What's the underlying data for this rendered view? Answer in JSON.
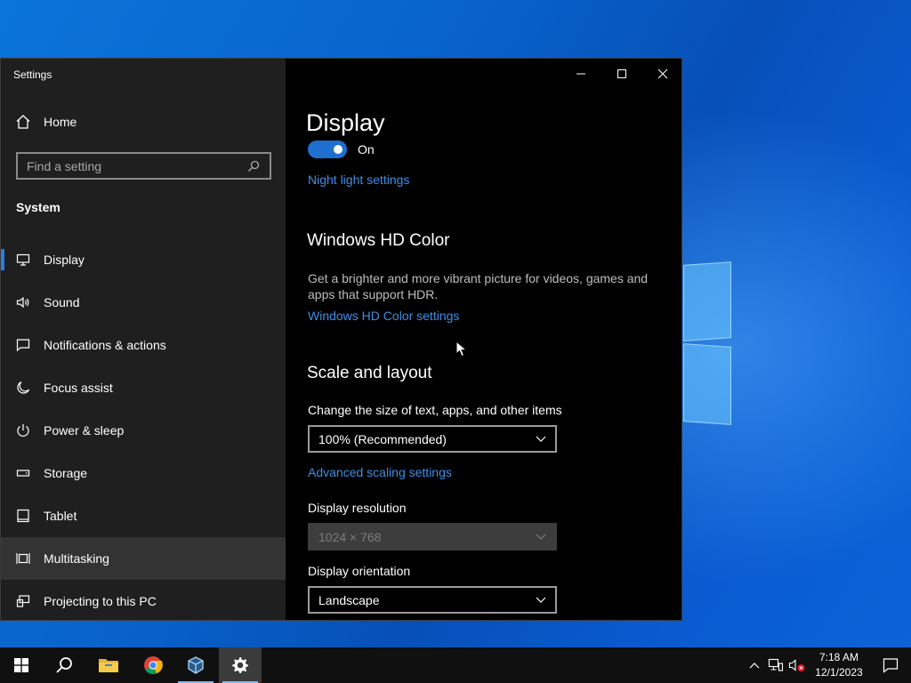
{
  "window": {
    "app_title": "Settings"
  },
  "sidebar": {
    "home_label": "Home",
    "search_placeholder": "Find a setting",
    "section_label": "System",
    "items": [
      {
        "label": "Display",
        "icon": "monitor-icon"
      },
      {
        "label": "Sound",
        "icon": "speaker-icon"
      },
      {
        "label": "Notifications & actions",
        "icon": "notification-icon"
      },
      {
        "label": "Focus assist",
        "icon": "moon-icon"
      },
      {
        "label": "Power & sleep",
        "icon": "power-icon"
      },
      {
        "label": "Storage",
        "icon": "storage-icon"
      },
      {
        "label": "Tablet",
        "icon": "tablet-icon"
      },
      {
        "label": "Multitasking",
        "icon": "multitasking-icon"
      },
      {
        "label": "Projecting to this PC",
        "icon": "projecting-icon"
      }
    ],
    "selected": "Display",
    "hovered": "Multitasking"
  },
  "content": {
    "page_title": "Display",
    "night_light_toggle": {
      "state_label": "On",
      "on": true
    },
    "night_light_link": "Night light settings",
    "hd_color": {
      "heading": "Windows HD Color",
      "description": "Get a brighter and more vibrant picture for videos, games and apps that support HDR.",
      "link": "Windows HD Color settings"
    },
    "scale_layout": {
      "heading": "Scale and layout",
      "scale_label": "Change the size of text, apps, and other items",
      "scale_value": "100% (Recommended)",
      "advanced_link": "Advanced scaling settings",
      "resolution_label": "Display resolution",
      "resolution_value": "1024 × 768",
      "orientation_label": "Display orientation",
      "orientation_value": "Landscape"
    }
  },
  "taskbar": {
    "apps": [
      "start-icon",
      "search-icon",
      "file-explorer-icon",
      "chrome-icon",
      "virtualbox-icon",
      "settings-icon"
    ],
    "clock_time": "7:18 AM",
    "clock_date": "12/1/2023"
  },
  "colors": {
    "accent": "#2b7de0",
    "link": "#3f8fe6",
    "sidebar_bg": "#1f1f1f",
    "content_bg": "#000000"
  }
}
